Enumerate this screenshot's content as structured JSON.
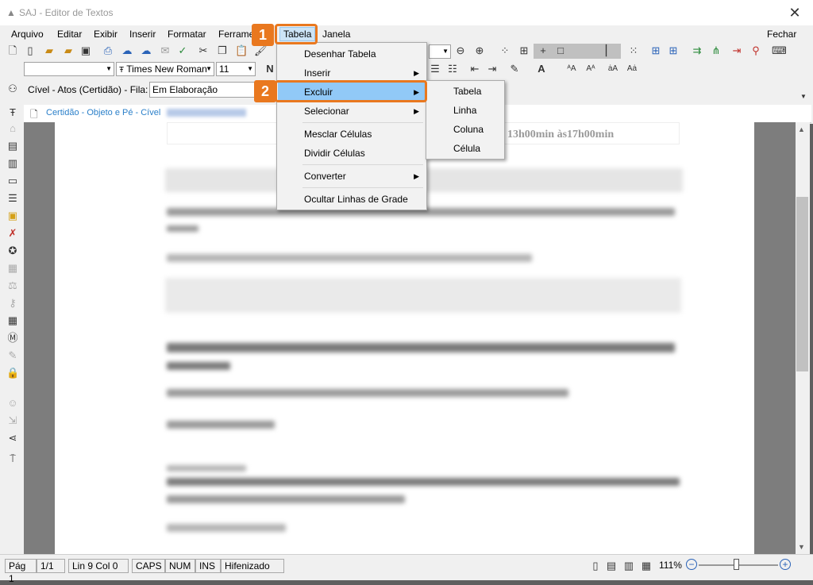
{
  "window": {
    "title": "SAJ - Editor de Textos"
  },
  "menubar": {
    "items": [
      {
        "label": "Arquivo",
        "access": "A"
      },
      {
        "label": "Editar",
        "access": "E"
      },
      {
        "label": "Exibir",
        "access": "x"
      },
      {
        "label": "Inserir",
        "access": "I"
      },
      {
        "label": "Formatar",
        "access": "F"
      },
      {
        "label": "Ferrame",
        "access": ""
      },
      {
        "label": "Tabela",
        "access": "a"
      },
      {
        "label": "Janela",
        "access": "J"
      }
    ],
    "close_label": "Fechar"
  },
  "format_toolbar": {
    "style_value": "",
    "font_value": "Times New Roman",
    "size_value": "11",
    "bold_label": "N"
  },
  "form_row": {
    "label": "Cível - Atos (Certidão) - Fila:",
    "fila_value": "Em Elaboração"
  },
  "doc_tab": {
    "label": "Certidão - Objeto e Pé - Cível"
  },
  "document": {
    "visible_text": "s 13h00min às17h00min"
  },
  "tabela_menu": {
    "items": [
      {
        "label": "Desenhar Tabela",
        "has_submenu": false
      },
      {
        "label": "Inserir",
        "has_submenu": true
      },
      {
        "label": "Excluir",
        "has_submenu": true,
        "highlighted": true
      },
      {
        "label": "Selecionar",
        "has_submenu": true
      },
      {
        "label": "Mesclar Células",
        "has_submenu": false
      },
      {
        "label": "Dividir Células",
        "has_submenu": false
      },
      {
        "label": "Converter",
        "has_submenu": true
      },
      {
        "label": "Ocultar Linhas de Grade",
        "has_submenu": false
      }
    ]
  },
  "excluir_submenu": {
    "items": [
      {
        "label": "Tabela"
      },
      {
        "label": "Linha"
      },
      {
        "label": "Coluna"
      },
      {
        "label": "Célula"
      }
    ]
  },
  "callouts": {
    "step1": "1",
    "step2": "2",
    "accent_color": "#e9781f"
  },
  "status": {
    "page": "Pág 1",
    "pages": "1/1",
    "position": "Lin 9  Col 0",
    "caps": "CAPS",
    "num": "NUM",
    "ins": "INS",
    "hyphen": "Hifenizado",
    "zoom": "111%"
  },
  "icons": [
    "app-logo-icon",
    "close-icon",
    "new-doc-icon",
    "open-icon",
    "save-icon",
    "print-icon",
    "cut-icon",
    "copy-icon",
    "paste-icon",
    "search-icon",
    "table-icon",
    "bullets-icon",
    "zoom-in-icon",
    "zoom-out-icon"
  ]
}
